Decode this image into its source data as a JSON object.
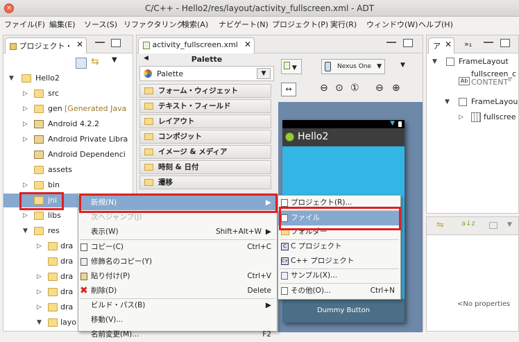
{
  "window": {
    "title": "C/C++ - Hello2/res/layout/activity_fullscreen.xml - ADT",
    "close": "×"
  },
  "menubar": [
    "ファイル(F)",
    "編集(E)",
    "ソース(S)",
    "リファクタリング",
    "検索(A)",
    "ナビゲート(N)",
    "プロジェクト(P)",
    "実行(R)",
    "ウィンドウ(W)",
    "ヘルプ(H)"
  ],
  "project_explorer": {
    "tab_label": "プロジェクト・",
    "rows": [
      {
        "label": "Hello2"
      },
      {
        "label": "src"
      },
      {
        "label": "gen",
        "extra": "[Generated Java"
      },
      {
        "label": "Android 4.2.2"
      },
      {
        "label": "Android Private Libra"
      },
      {
        "label": "Android Dependenci"
      },
      {
        "label": "assets"
      },
      {
        "label": "bin"
      },
      {
        "label": "jni"
      },
      {
        "label": "libs"
      },
      {
        "label": "res"
      },
      {
        "label": "dra"
      },
      {
        "label": "dra"
      },
      {
        "label": "dra"
      },
      {
        "label": "dra"
      },
      {
        "label": "dra"
      },
      {
        "label": "layo"
      }
    ]
  },
  "editor": {
    "tab_label": "activity_fullscreen.xml",
    "palette_title": "Palette",
    "palette_dropdown": "Palette",
    "palette_items": [
      "フォーム・ウィジェット",
      "テキスト・フィールド",
      "レイアウト",
      "コンポジット",
      "イメージ & メディア",
      "時刻 & 日付",
      "遷移"
    ],
    "device": "Nexus One",
    "app_title": "Hello2",
    "dummy_button": "Dummy Button"
  },
  "outline": {
    "tab_label": "ア",
    "rows": [
      "FrameLayout",
      "fullscreen_c",
      "CONTENT\"",
      "FrameLayou",
      "fullscree"
    ],
    "no_properties": "<No properties"
  },
  "context_menu": {
    "items": [
      {
        "label": "新規(N)",
        "accel": ""
      },
      {
        "label": "次へジャンプ(J)",
        "accel": ""
      },
      {
        "label": "表示(W)",
        "accel": "Shift+Alt+W"
      },
      {
        "label": "コピー(C)",
        "accel": "Ctrl+C"
      },
      {
        "label": "修飾名のコピー(Y)",
        "accel": ""
      },
      {
        "label": "貼り付け(P)",
        "accel": "Ctrl+V"
      },
      {
        "label": "削除(D)",
        "accel": "Delete"
      },
      {
        "label": "ビルド・パス(B)",
        "accel": ""
      },
      {
        "label": "移動(V)...",
        "accel": ""
      },
      {
        "label": "名前変更(M)...",
        "accel": "F2"
      }
    ]
  },
  "submenu": {
    "items": [
      {
        "label": "プロジェクト(R)...",
        "accel": ""
      },
      {
        "label": "ファイル",
        "accel": ""
      },
      {
        "label": "フォルダー",
        "accel": ""
      },
      {
        "label": "C プロジェクト",
        "accel": ""
      },
      {
        "label": "C++ プロジェクト",
        "accel": ""
      },
      {
        "label": "サンプル(X)...",
        "accel": ""
      },
      {
        "label": "その他(O)...",
        "accel": "Ctrl+N"
      }
    ]
  },
  "colors": {
    "highlight": "#87a9cf",
    "device_blue": "#33b5e5",
    "red_box": "#e0201e",
    "action_bar": "#3d3d3d"
  }
}
